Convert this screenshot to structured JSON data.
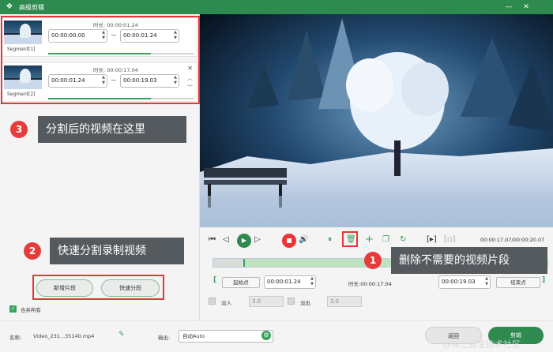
{
  "window": {
    "title": "高级剪辑",
    "minimize": "—",
    "close": "✕"
  },
  "segments": [
    {
      "name": "Segment[1]",
      "duration_label": "时长: 00:00:01.24",
      "start": "00:00:00.00",
      "end": "00:00:01.24"
    },
    {
      "name": "Segment[2]",
      "duration_label": "时长: 00:00:17.04",
      "start": "00:00:01.24",
      "end": "00:00:19.03"
    }
  ],
  "callouts": {
    "c1_num": "1",
    "c1_text": "删除不需要的视频片段",
    "c2_num": "2",
    "c2_text": "快速分割录制视频",
    "c3_num": "3",
    "c3_text": "分割后的视频在这里"
  },
  "left_buttons": {
    "add_segment": "新增片段",
    "quick_split": "快速分段"
  },
  "merge_all": {
    "label": "合并所有",
    "checked": true
  },
  "player": {
    "time_display": "00:00:17.07/00:00:20.07",
    "start_point_label": "起始点",
    "start_time": "00:00:01.24",
    "duration_label": "时长:00:00:17.04",
    "end_time": "00:00:19.03",
    "end_point_label": "结束点",
    "fade_in_label": "淡入",
    "fade_in_value": "3.0",
    "fade_out_label": "淡出",
    "fade_out_value": "3.0"
  },
  "bottom": {
    "name_label": "名称:",
    "file_name": "Video_231...35140.mp4",
    "output_label": "输出:",
    "output_value": "自动Auto",
    "back_label": "返回",
    "cut_label": "剪辑",
    "watermark": "@稀土掘金技术社区"
  },
  "colors": {
    "accent": "#2f8a50",
    "highlight_box": "#ee3333",
    "callout_bg": "#555a5f",
    "callout_badge": "#e83b3b"
  }
}
